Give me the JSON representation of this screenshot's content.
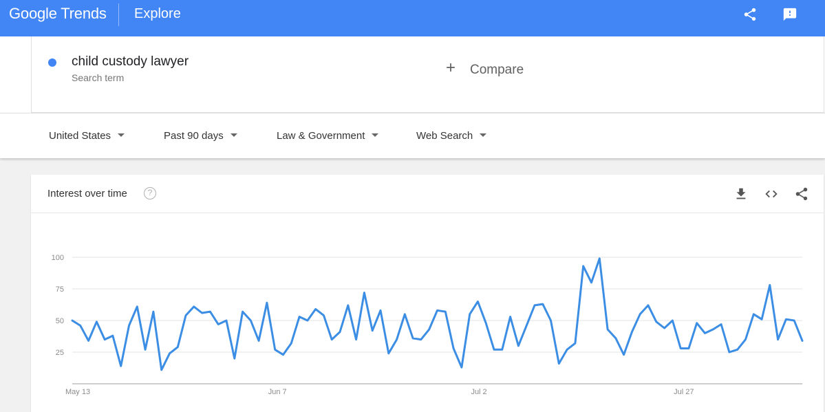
{
  "header": {
    "logo_text": "Google Trends",
    "section_title": "Explore",
    "icons": [
      "share-icon",
      "feedback-icon"
    ]
  },
  "search_term": {
    "name": "child custody lawyer",
    "type": "Search term",
    "color": "#4285f4"
  },
  "compare": {
    "plus": "+",
    "label": "Compare"
  },
  "filters": {
    "region": "United States",
    "time_range": "Past 90 days",
    "category": "Law & Government",
    "search_type": "Web Search"
  },
  "interest_card": {
    "title": "Interest over time",
    "help_glyph": "?",
    "icons": [
      "download-icon",
      "embed-icon",
      "share-icon"
    ]
  },
  "colors": {
    "header": "#4285f4",
    "series": "#4285f4",
    "line": "#3c8ee5"
  },
  "chart_data": {
    "type": "line",
    "x_labels": [
      "May 13",
      "Jun 7",
      "Jul 2",
      "Jul 27"
    ],
    "y_ticks": [
      25,
      50,
      75,
      100
    ],
    "ylim": [
      0,
      100
    ],
    "grid": true,
    "legend": "none",
    "series": [
      {
        "name": "child custody lawyer",
        "values": [
          50,
          46,
          34,
          49,
          35,
          38,
          14,
          46,
          61,
          27,
          57,
          11,
          24,
          29,
          54,
          61,
          56,
          57,
          47,
          50,
          20,
          57,
          50,
          34,
          64,
          27,
          23,
          32,
          53,
          50,
          59,
          54,
          35,
          41,
          62,
          35,
          72,
          42,
          58,
          24,
          35,
          55,
          36,
          35,
          43,
          58,
          57,
          28,
          13,
          55,
          65,
          48,
          27,
          27,
          53,
          30,
          46,
          62,
          63,
          50,
          16,
          27,
          32,
          93,
          80,
          99,
          43,
          36,
          23,
          41,
          55,
          62,
          49,
          44,
          50,
          28,
          28,
          48,
          40,
          43,
          47,
          25,
          27,
          35,
          55,
          51,
          78,
          35,
          51,
          50,
          34
        ]
      }
    ]
  }
}
